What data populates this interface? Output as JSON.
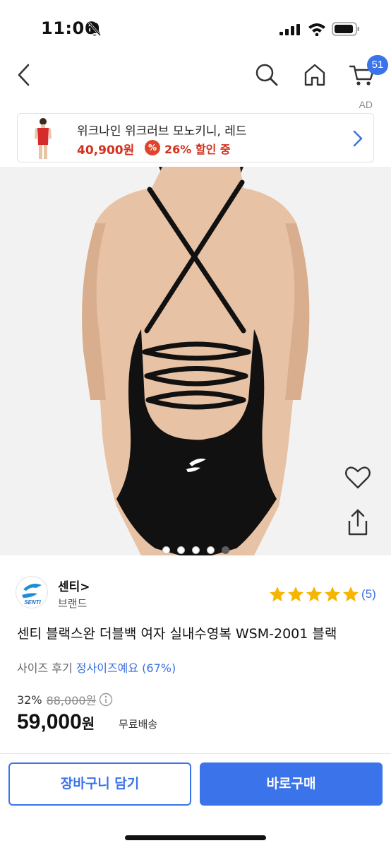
{
  "status_bar": {
    "time": "11:06"
  },
  "nav": {
    "cart_count": "51",
    "ad_label": "AD"
  },
  "ad_banner": {
    "title": "위크나인 위크러브 모노키니, 레드",
    "price": "40,900원",
    "pct_symbol": "%",
    "discount": "26% 할인 중"
  },
  "gallery": {
    "total": 5,
    "active_index": 4
  },
  "brand": {
    "name": "센티",
    "chevron": ">",
    "sub": "브랜드",
    "logo_text": "SENTI"
  },
  "rating": {
    "stars": 5,
    "count": "(5)"
  },
  "product": {
    "title": "센티 블랙스완 더블백 여자 실내수영복 WSM-2001 블랙",
    "size_label": "사이즈 후기",
    "size_value": "정사이즈예요 (67%)",
    "discount_rate": "32%",
    "original_price": "88,000원",
    "price": "59,000",
    "price_unit": "원",
    "shipping": "무료배송"
  },
  "actions": {
    "cart": "장바구니 담기",
    "buy": "바로구매"
  },
  "colors": {
    "accent": "#3b73ea",
    "sale_red": "#d4301d",
    "star": "#f6b500"
  }
}
